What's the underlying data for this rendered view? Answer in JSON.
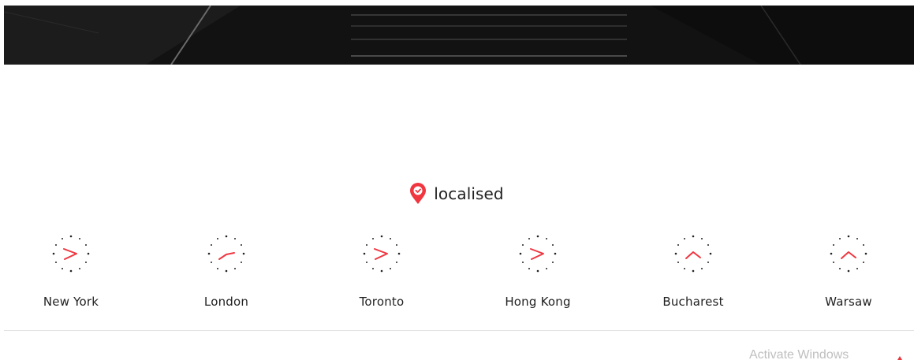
{
  "brand": {
    "name": "localised",
    "icon": "map-pin-clock-icon",
    "accent_color": "#f0363f"
  },
  "hero": {
    "background_color": "#111111"
  },
  "cities": [
    {
      "name": "New York"
    },
    {
      "name": "London"
    },
    {
      "name": "Toronto"
    },
    {
      "name": "Hong Kong"
    },
    {
      "name": "Bucharest"
    },
    {
      "name": "Warsaw"
    }
  ],
  "watermark": {
    "text": "Activate Windows"
  }
}
